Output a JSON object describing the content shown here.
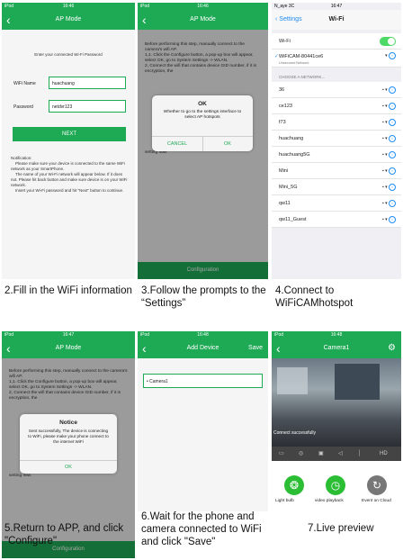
{
  "captions": {
    "c2": "2.Fill in the WiFi information",
    "c3": "3.Follow the prompts to the “Settings”",
    "c4": "4.Connect to WiFiCAMhotspot",
    "c5": "5.Return to APP, and click \"Configure\"",
    "c6": "6.Wait for the phone and camera connected to WiFi and click \"Save\"",
    "c7": "7.Live preview"
  },
  "p2": {
    "status_left": "iPod",
    "status_time": "16:46",
    "title": "AP Mode",
    "prompt": "Enter your connected Wi-Fi Password",
    "wifi_label": "WiFi Name",
    "wifi_value": "huachuang",
    "pass_label": "Password",
    "pass_value": "netdvr123",
    "next": "NEXT",
    "notes": "Notification:\n    Please make sure your device is connected to the same WiFi network as your SmartPhone.\n    The name of your Wi-Fi network will appear below. If it does not. Please hit back button and make sure device is on your WiFi network.\n    Insert your Wi-Fi password and hit \"Next\" button to continue."
  },
  "p3": {
    "status_left": "iPod",
    "status_time": "16:46",
    "title": "AP Mode",
    "body": "Before performing this step, manually connect to the camera's wifi AP.\n1,1. Click the Configure button, a pop-up box will appear, select OK, go to System Settings -> WLAN.\n2, Connect the wifi that contains device GID number, if it is encryption, the",
    "dialog_title": "OK",
    "dialog_msg": "Whether to go to the settings interface to select AP hotspots",
    "cancel": "CANCEL",
    "ok": "OK",
    "tail": "setting flow.",
    "footer": "Configuration"
  },
  "p4": {
    "status_left": "N_aye 3C",
    "status_time": "16:47",
    "back": "Settings",
    "title": "Wi-Fi",
    "wifi": "Wi-Fi",
    "connected": "WiFiCAM-80441ce6",
    "connected_sub": "Unsecured Network",
    "choose": "CHOOSE A NETWORK...",
    "networks": [
      "36",
      "ce123",
      "f73",
      "huachuang",
      "huachuang5G",
      "Mini",
      "Mini_5G",
      "qw11",
      "qw11_Guest"
    ]
  },
  "p5": {
    "status_left": "iPod",
    "status_time": "16:47",
    "title": "AP Mode",
    "body": "Before performing this step, manually connect to the camera's wifi AP.\n1,1. Click the Configure button, a pop-up box will appear, select OK, go to System Settings -> WLAN.\n2, Connect the wifi that contains device GID number, if it is encryption, the",
    "dialog_title": "Notice",
    "dialog_msg": "Sent successfully, The device is connecting to WiFi, please make your phone connect to the internet WiFi",
    "ok": "OK",
    "tail": "setting flow.",
    "footer": "Configuration"
  },
  "p6": {
    "status_left": "iPod",
    "status_time": "16:48",
    "title": "Add Device",
    "save": "Save",
    "field": "Camera1"
  },
  "p7": {
    "status_left": "iPod",
    "status_time": "16:48",
    "title": "Camera1",
    "toast": "Connect successfully",
    "hd": "HD",
    "btn1": "Light bulb",
    "btn2": "video playback",
    "btn3": "Event on Cloud"
  }
}
